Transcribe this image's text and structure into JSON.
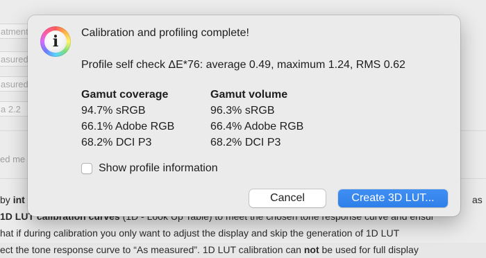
{
  "background": {
    "fields": [
      "atment",
      "asured",
      "asured",
      "a 2.2"
    ],
    "label": "ed me",
    "para_lines": [
      {
        "parts": [
          {
            "t": "by ",
            "b": false
          },
          {
            "t": "int",
            "b": true
          }
        ],
        "right": "as"
      },
      {
        "parts": [
          {
            "t": "1D LUT calibration curves",
            "b": true
          },
          {
            "t": " (1D - Look Up Table) to meet the chosen tone response curve and ensur",
            "b": false
          }
        ],
        "right": ""
      },
      {
        "parts": [
          {
            "t": "hat if during calibration you only want to adjust the display and skip the generation of 1D LUT",
            "b": false
          }
        ],
        "right": ""
      },
      {
        "parts": [
          {
            "t": "ect the tone response curve to “As measured”. 1D LUT calibration can ",
            "b": false
          },
          {
            "t": "not",
            "b": true
          },
          {
            "t": " be used for full display",
            "b": false
          }
        ],
        "right": ""
      }
    ],
    "para_right_2": "ensure"
  },
  "dialog": {
    "icon": "info-icon",
    "icon_glyph": "i",
    "title": "Calibration and profiling complete!",
    "self_check": "Profile self check ΔE*76: average 0.49, maximum 1.24, RMS 0.62",
    "coverage": {
      "header": "Gamut coverage",
      "rows": [
        "94.7% sRGB",
        "66.1% Adobe RGB",
        "68.2% DCI P3"
      ]
    },
    "volume": {
      "header": "Gamut volume",
      "rows": [
        "96.3% sRGB",
        "66.4% Adobe RGB",
        "68.2% DCI P3"
      ]
    },
    "show_profile_info": {
      "label": "Show profile information",
      "checked": false
    },
    "cancel_label": "Cancel",
    "create_lut_label": "Create 3D LUT..."
  },
  "colors": {
    "accent": "#3184ee",
    "dialog_bg": "#ebebeb"
  }
}
